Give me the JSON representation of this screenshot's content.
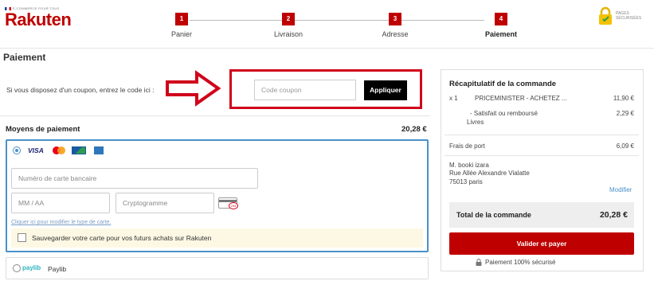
{
  "header": {
    "logo_tagline": "E-COMMERCE POUR TOUS",
    "logo_brand": "Rakuten",
    "secure_label_line1": "PAGES",
    "secure_label_line2": "SÉCURISÉES",
    "steps": [
      {
        "num": "1",
        "label": "Panier"
      },
      {
        "num": "2",
        "label": "Livraison"
      },
      {
        "num": "3",
        "label": "Adresse"
      },
      {
        "num": "4",
        "label": "Paiement"
      }
    ],
    "active_step": 4
  },
  "page": {
    "title": "Paiement"
  },
  "coupon": {
    "prompt": "Si vous disposez d'un coupon, entrez le code ici :",
    "placeholder": "Code coupon",
    "apply_label": "Appliquer"
  },
  "payment": {
    "title": "Moyens de paiement",
    "amount": "20,28 €",
    "card_logos": [
      "VISA",
      "mastercard-icon",
      "cb-icon",
      "amex-icon"
    ],
    "card_number_placeholder": "Numéro de carte bancaire",
    "expiry_placeholder": "MM / AA",
    "cvv_placeholder": "Cryptogramme",
    "cvv_badge": "234",
    "change_card_link": "Cliquer ici pour modifier le type de carte.",
    "save_card_label": "Sauvegarder votre carte pour vos futurs achats sur Rakuten",
    "paylib_logo": "paylib",
    "paylib_label": "Paylib"
  },
  "summary": {
    "title": "Récapitulatif de la commande",
    "item_qty": "x 1",
    "item_name": "PRICEMINISTER - ACHETEZ ...",
    "item_price": "11,90 €",
    "option_line1": "- Satisfait ou remboursé",
    "option_line2": "Livres",
    "option_price": "2,29 €",
    "shipping_label": "Frais de port",
    "shipping_price": "6,09 €",
    "address_name": "M. booki izara",
    "address_street": "Rue Allée Alexandre Vialatte",
    "address_city": "75013 paris",
    "modify_label": "Modifier",
    "total_label": "Total de la commande",
    "total_value": "20,28 €",
    "pay_button": "Valider et payer",
    "secure_note": "Paiement 100% sécurisé"
  },
  "colors": {
    "brand_red": "#bf0000",
    "highlight_red": "#d0021b",
    "accent_blue": "#4a90c8"
  }
}
